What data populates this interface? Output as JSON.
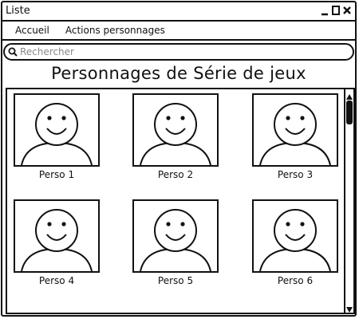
{
  "window": {
    "title": "Liste"
  },
  "menubar": {
    "items": [
      {
        "label": "Accueil"
      },
      {
        "label": "Actions personnages"
      }
    ]
  },
  "search": {
    "placeholder": "Rechercher",
    "value": ""
  },
  "page": {
    "title": "Personnages de Série de jeux"
  },
  "characters": [
    {
      "name": "Perso 1",
      "icon": "avatar-icon"
    },
    {
      "name": "Perso 2",
      "icon": "avatar-icon"
    },
    {
      "name": "Perso 3",
      "icon": "avatar-icon"
    },
    {
      "name": "Perso 4",
      "icon": "avatar-icon"
    },
    {
      "name": "Perso 5",
      "icon": "avatar-icon"
    },
    {
      "name": "Perso 6",
      "icon": "avatar-icon"
    }
  ]
}
